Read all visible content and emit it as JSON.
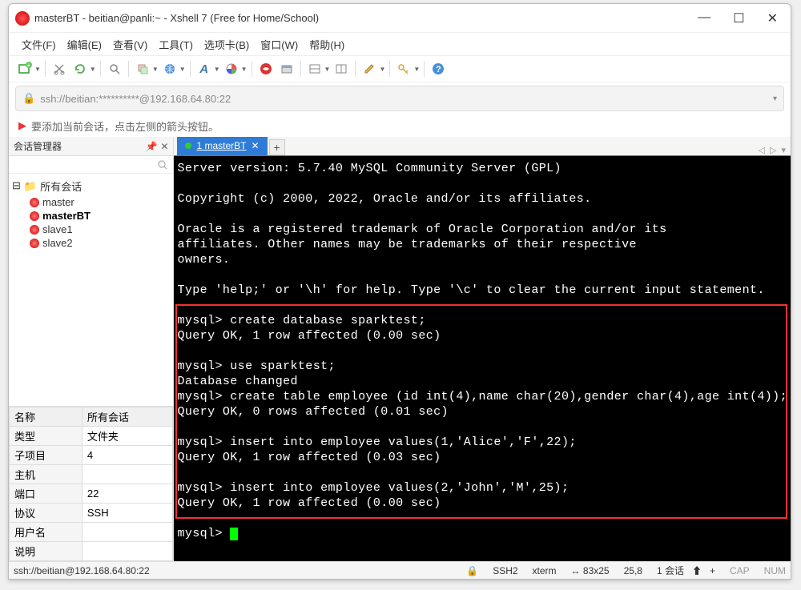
{
  "titlebar": {
    "title": "masterBT - beitian@panli:~ - Xshell 7 (Free for Home/School)"
  },
  "menubar": [
    "文件(F)",
    "编辑(E)",
    "查看(V)",
    "工具(T)",
    "选项卡(B)",
    "窗口(W)",
    "帮助(H)"
  ],
  "addressbar": {
    "text": "ssh://beitian:**********@192.168.64.80:22"
  },
  "hint": "要添加当前会话，点击左侧的箭头按钮。",
  "sidebar": {
    "title": "会话管理器",
    "root": "所有会话",
    "items": [
      {
        "label": "master",
        "selected": false
      },
      {
        "label": "masterBT",
        "selected": true
      },
      {
        "label": "slave1",
        "selected": false
      },
      {
        "label": "slave2",
        "selected": false
      }
    ]
  },
  "propgrid": {
    "header_left": "名称",
    "header_right": "所有会话",
    "rows": [
      {
        "k": "类型",
        "v": "文件夹"
      },
      {
        "k": "子项目",
        "v": "4"
      },
      {
        "k": "主机",
        "v": ""
      },
      {
        "k": "端口",
        "v": "22"
      },
      {
        "k": "协议",
        "v": "SSH"
      },
      {
        "k": "用户名",
        "v": ""
      },
      {
        "k": "说明",
        "v": ""
      }
    ]
  },
  "tab": {
    "label": "1 masterBT"
  },
  "terminal_lines": [
    "Server version: 5.7.40 MySQL Community Server (GPL)",
    "",
    "Copyright (c) 2000, 2022, Oracle and/or its affiliates.",
    "",
    "Oracle is a registered trademark of Oracle Corporation and/or its",
    "affiliates. Other names may be trademarks of their respective",
    "owners.",
    "",
    "Type 'help;' or '\\h' for help. Type '\\c' to clear the current input statement.",
    "",
    "mysql> create database sparktest;",
    "Query OK, 1 row affected (0.00 sec)",
    "",
    "mysql> use sparktest;",
    "Database changed",
    "mysql> create table employee (id int(4),name char(20),gender char(4),age int(4));",
    "Query OK, 0 rows affected (0.01 sec)",
    "",
    "mysql> insert into employee values(1,'Alice','F',22);",
    "Query OK, 1 row affected (0.03 sec)",
    "",
    "mysql> insert into employee values(2,'John','M',25);",
    "Query OK, 1 row affected (0.00 sec)",
    "",
    "mysql> "
  ],
  "redbox_top_line": 10,
  "statusbar": {
    "left": "ssh://beitian@192.168.64.80:22",
    "proto": "SSH2",
    "term": "xterm",
    "size": "83x25",
    "pos": "25,8",
    "sessions": "1 会话",
    "cap": "CAP",
    "num": "NUM"
  }
}
